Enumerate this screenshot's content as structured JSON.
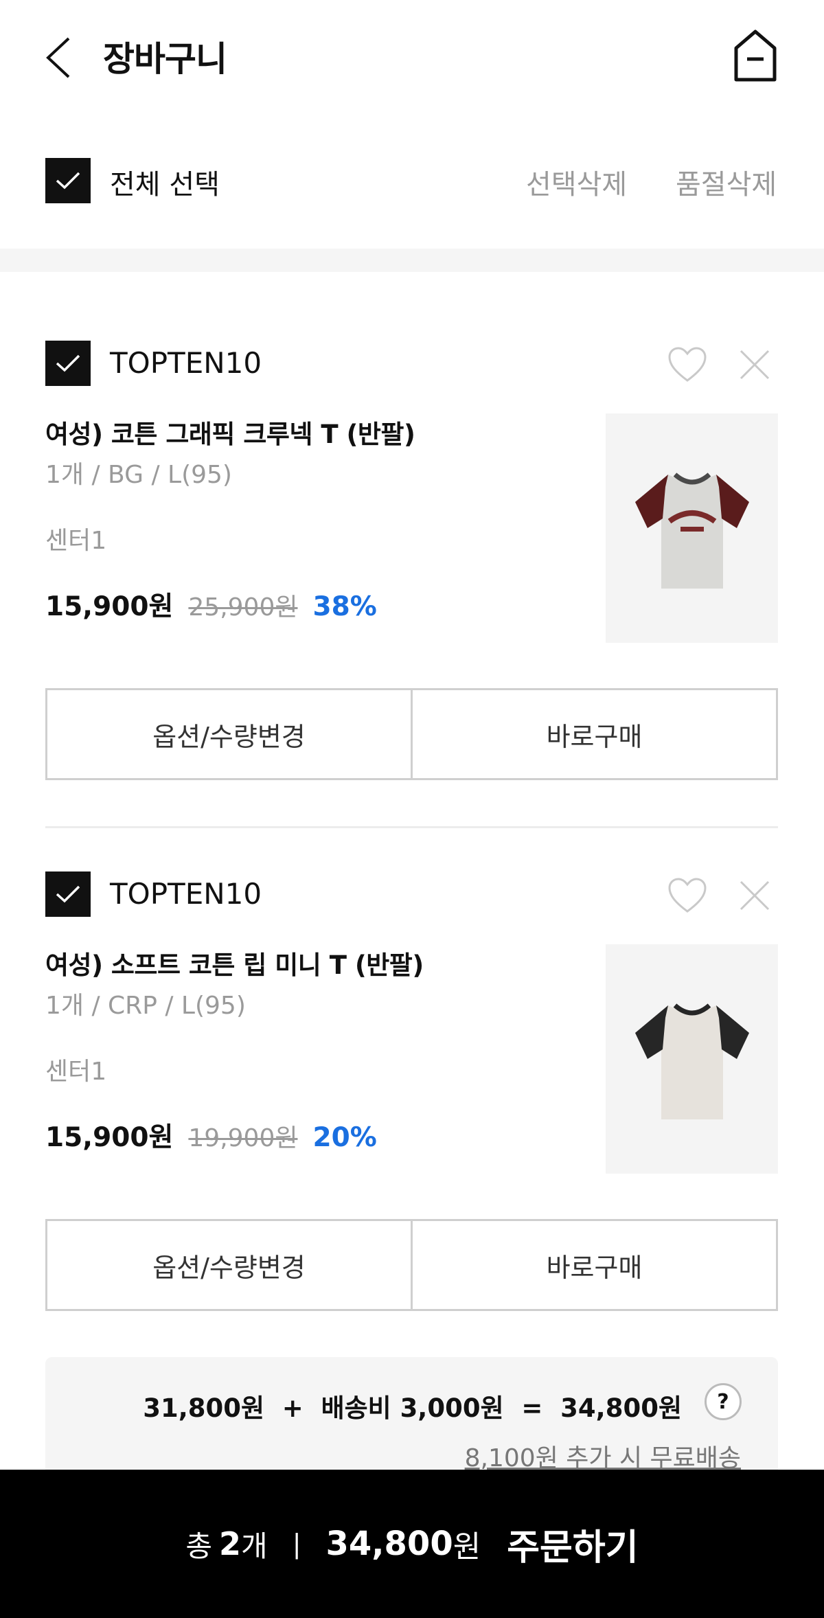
{
  "header": {
    "title": "장바구니"
  },
  "select_bar": {
    "select_all_label": "전체 선택",
    "delete_selected": "선택삭제",
    "delete_soldout": "품절삭제"
  },
  "items": [
    {
      "brand": "TOPTEN10",
      "name": "여성) 코튼 그래픽 크루넥 T (반팔)",
      "option": "1개 / BG / L(95)",
      "center": "센터1",
      "price": "15,900원",
      "original_price": "25,900원",
      "discount": "38%",
      "change_option_label": "옵션/수량변경",
      "buy_now_label": "바로구매"
    },
    {
      "brand": "TOPTEN10",
      "name": "여성) 소프트 코튼 립 미니 T (반팔)",
      "option": "1개 / CRP / L(95)",
      "center": "센터1",
      "price": "15,900원",
      "original_price": "19,900원",
      "discount": "20%",
      "change_option_label": "옵션/수량변경",
      "buy_now_label": "바로구매"
    }
  ],
  "summary": {
    "line": "31,800원  +  배송비 3,000원  =  34,800원",
    "help": "?",
    "free_shipping_note": "8,100원 추가 시 무료배송"
  },
  "bottom_bar": {
    "count_label": "총",
    "count": "2",
    "count_unit": "개",
    "separator": "|",
    "total": "34,800",
    "total_unit": "원",
    "order_label": "주문하기"
  },
  "colors": {
    "discount": "#1a6fe0",
    "muted": "#9a9a9a",
    "bar": "#000000"
  }
}
